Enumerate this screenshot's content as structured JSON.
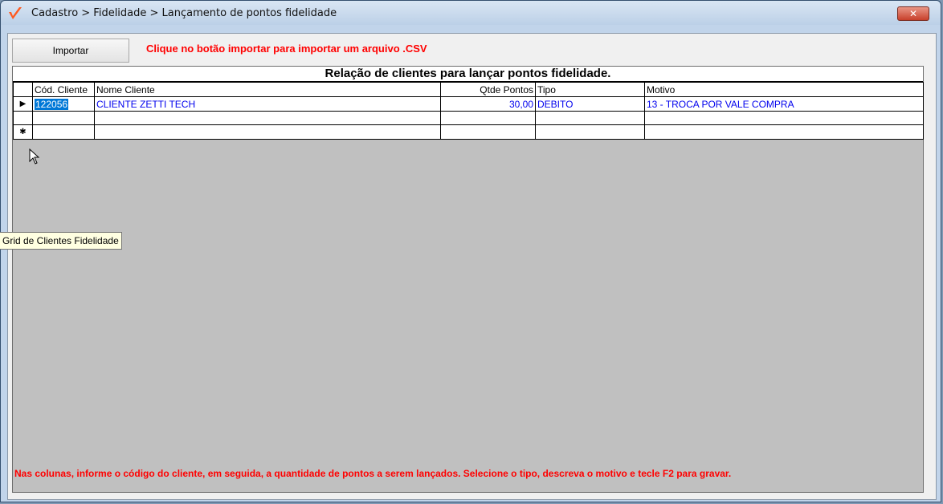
{
  "window": {
    "title": "Cadastro > Fidelidade > Lançamento de pontos fidelidade",
    "close_icon": "close-icon",
    "accent_color": "#ff5a1f"
  },
  "toolbar": {
    "import_label": "Importar",
    "hint_text": "Clique no botão importar para importar um arquivo .CSV"
  },
  "grid": {
    "caption": "Relação de clientes para lançar pontos fidelidade.",
    "columns": [
      "Cód. Cliente",
      "Nome Cliente",
      "Qtde Pontos",
      "Tipo",
      "Motivo"
    ],
    "rows": [
      {
        "indicator": "▶",
        "cod_cliente": "122056",
        "nome_cliente": "CLIENTE ZETTI TECH",
        "qtde_pontos": "30,00",
        "tipo": "DEBITO",
        "motivo": "13 - TROCA POR VALE COMPRA"
      },
      {
        "indicator": "",
        "cod_cliente": "",
        "nome_cliente": "",
        "qtde_pontos": "",
        "tipo": "",
        "motivo": ""
      },
      {
        "indicator": "✱",
        "cod_cliente": "",
        "nome_cliente": "",
        "qtde_pontos": "",
        "tipo": "",
        "motivo": ""
      }
    ],
    "dropdown_icon": "chevron-down-icon"
  },
  "footer_text": "Nas colunas, informe o código do cliente, em seguida, a quantidade de pontos a serem lançados. Selecione o tipo, descreva o motivo e tecle F2 para gravar.",
  "tooltip_text": "Grid de Clientes Fidelidade"
}
